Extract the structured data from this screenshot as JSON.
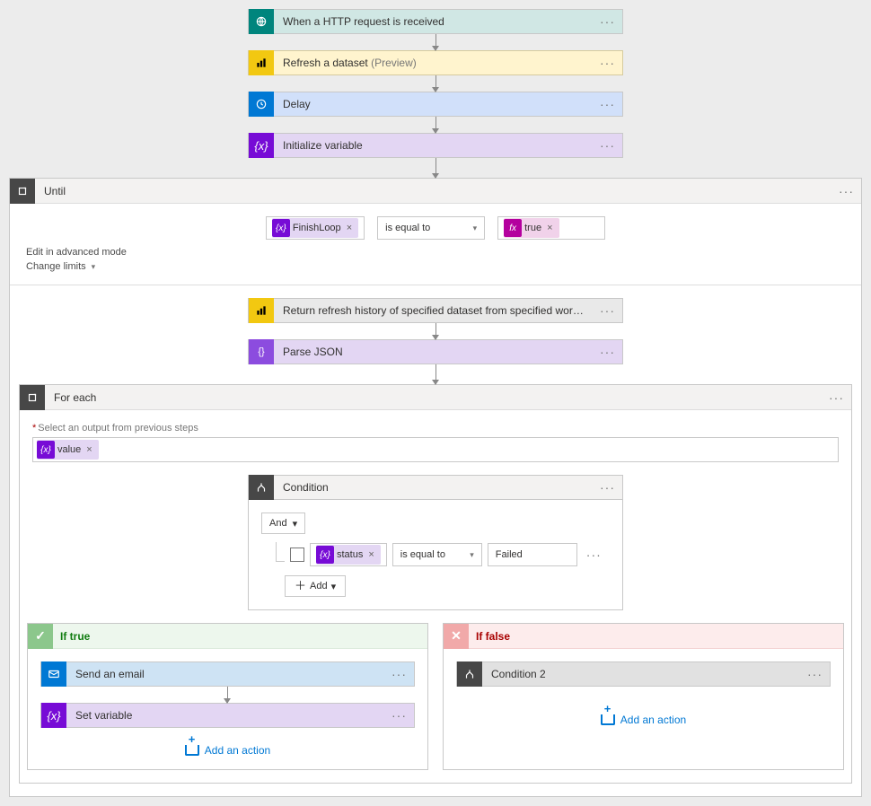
{
  "cards": {
    "http": {
      "title": "When a HTTP request is received"
    },
    "refresh": {
      "title": "Refresh a dataset",
      "suffix": " (Preview)"
    },
    "delay": {
      "title": "Delay"
    },
    "initvar": {
      "title": "Initialize variable"
    },
    "until": {
      "title": "Until"
    },
    "history": {
      "title": "Return refresh history of specified dataset from specified workspace"
    },
    "parsejson": {
      "title": "Parse JSON"
    },
    "foreach": {
      "title": "For each"
    },
    "condition": {
      "title": "Condition"
    },
    "condition2": {
      "title": "Condition 2"
    },
    "email": {
      "title": "Send an email"
    },
    "setvar": {
      "title": "Set variable"
    }
  },
  "until": {
    "chip_label": "FinishLoop",
    "operator": "is equal to",
    "fx_label": "true",
    "link_edit": "Edit in advanced mode",
    "link_limits": "Change limits"
  },
  "foreach": {
    "field_label": "Select an output from previous steps",
    "chip_label": "value"
  },
  "condition": {
    "group_op": "And",
    "chip_label": "status",
    "operator": "is equal to",
    "value": "Failed",
    "add_label": "Add"
  },
  "branches": {
    "true_label": "If true",
    "false_label": "If false",
    "add_action": "Add an action"
  }
}
